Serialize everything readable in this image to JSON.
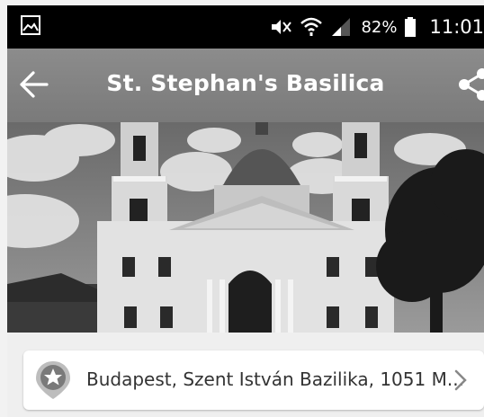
{
  "status_bar": {
    "battery_percent": "82%",
    "time": "11:01",
    "icons": [
      "image-icon",
      "mute-icon",
      "wifi-icon",
      "signal-icon",
      "battery-icon"
    ]
  },
  "toolbar": {
    "title": "St. Stephan's Basilica",
    "back_icon": "arrow-left-icon",
    "share_icon": "share-icon"
  },
  "hero": {
    "subject": "basilica-photo"
  },
  "address": {
    "text": "Budapest, Szent István Bazilika, 1051 M...",
    "icon": "location-star-icon",
    "chevron": "chevron-right-icon"
  },
  "colors": {
    "status_bg": "#000000",
    "toolbar_bg": "#858585",
    "card_bg": "#ffffff",
    "section_bg": "#efefef"
  }
}
